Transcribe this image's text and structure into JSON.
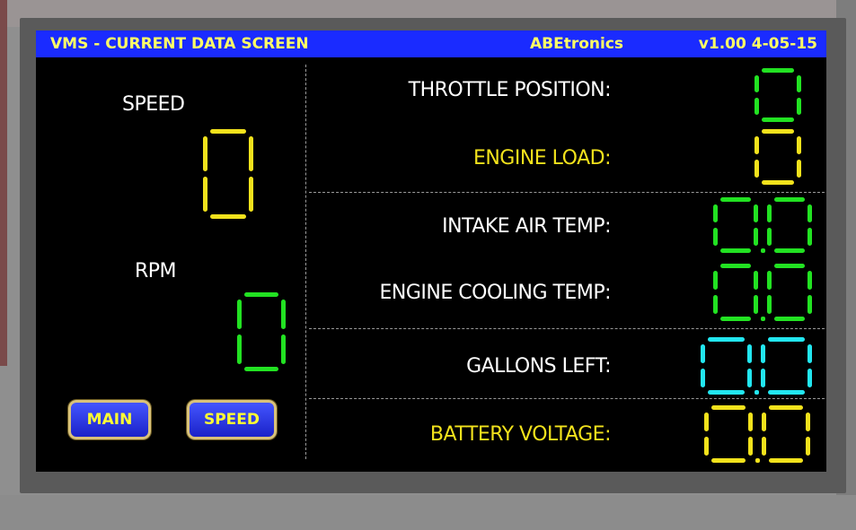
{
  "header": {
    "title": "VMS - CURRENT DATA SCREEN",
    "brand": "ABEtronics",
    "version": "v1.00 4-05-15"
  },
  "left": {
    "speed_label": "SPEED",
    "speed_value": "0",
    "rpm_label": "RPM",
    "rpm_value": "0"
  },
  "readings": {
    "throttle_label": "THROTTLE POSITION:",
    "throttle_value": "0",
    "engine_load_label": "ENGINE LOAD:",
    "engine_load_value": "0",
    "intake_label": "INTAKE AIR TEMP:",
    "intake_value": "0.0",
    "cooling_label": "ENGINE COOLING TEMP:",
    "cooling_value": "0.0",
    "gallons_label": "GALLONS LEFT:",
    "gallons_value": "0.0",
    "battery_label": "BATTERY VOLTAGE:",
    "battery_value": "0.0"
  },
  "buttons": {
    "main_label": "MAIN",
    "speed_label": "SPEED"
  },
  "colors": {
    "title_bg": "#1a2bff",
    "title_text": "#ffff66",
    "green": "#22e222",
    "yellow": "#f2e21c",
    "cyan": "#22e6f0",
    "white": "#ffffff"
  }
}
